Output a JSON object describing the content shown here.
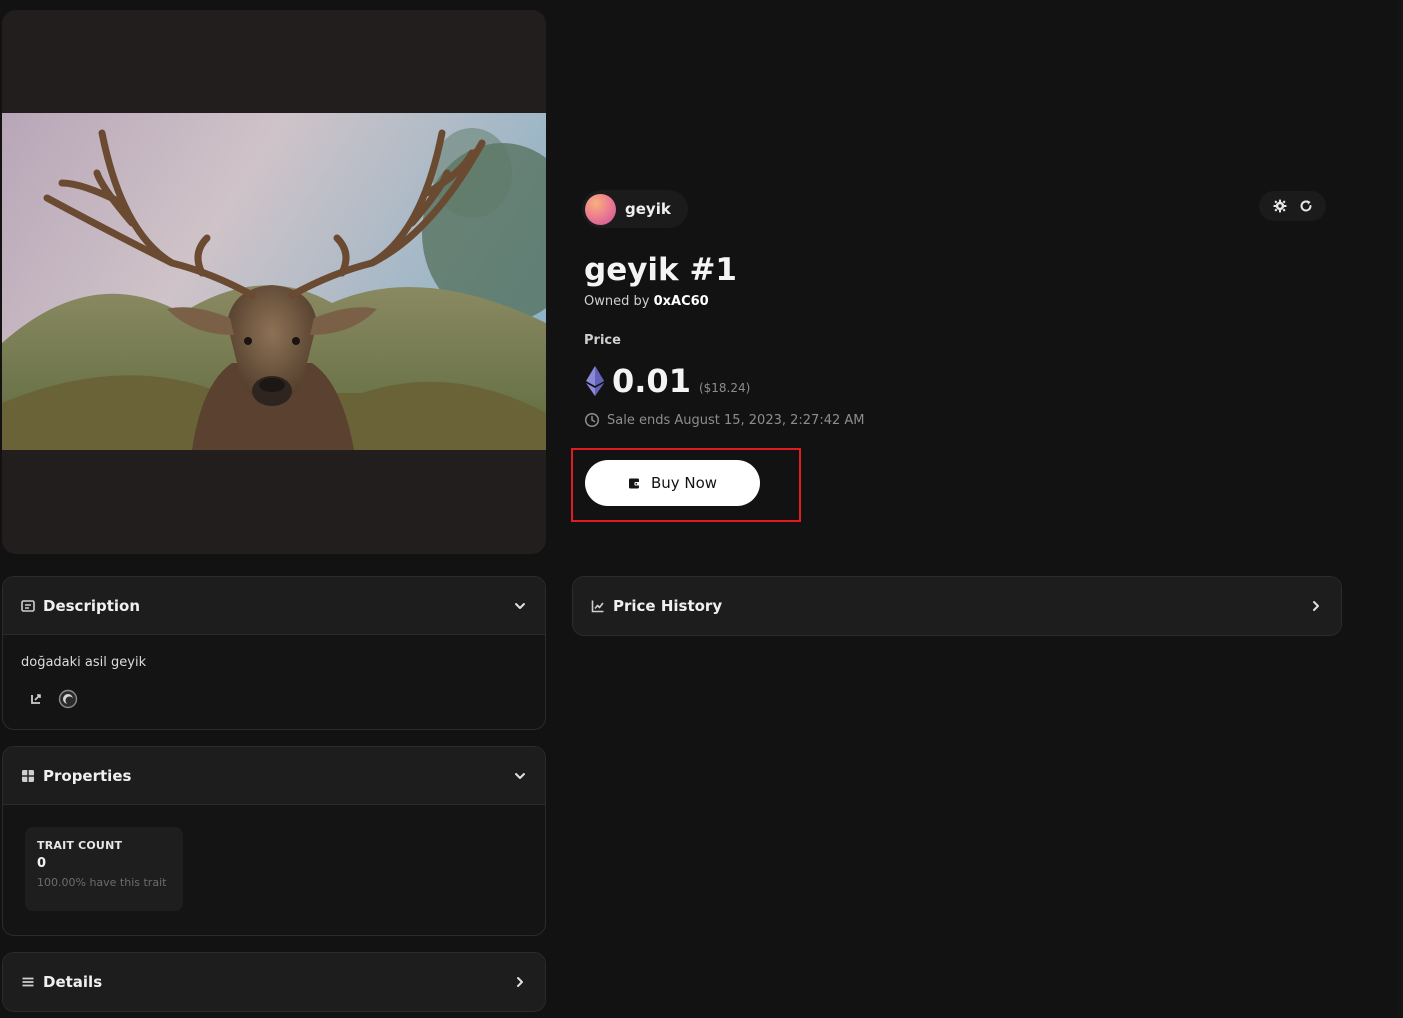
{
  "collection": {
    "name": "geyik"
  },
  "item": {
    "title": "geyik #1",
    "owned_by_label": "Owned by",
    "owner": "0xAC60"
  },
  "price": {
    "label": "Price",
    "value": "0.01",
    "usd": "($18.24)",
    "currency_icon": "ethereum-icon",
    "sale_ends": "Sale ends August 15, 2023, 2:27:42 AM"
  },
  "buy_button": {
    "label": "Buy Now"
  },
  "panels": {
    "description": {
      "title": "Description",
      "text": "doğadaki asil geyik"
    },
    "properties": {
      "title": "Properties",
      "traits": [
        {
          "type": "TRAIT COUNT",
          "value": "0",
          "rarity": "100.00% have this trait"
        }
      ]
    },
    "details": {
      "title": "Details"
    },
    "price_history": {
      "title": "Price History"
    }
  },
  "colors": {
    "background": "#121212",
    "panel_header": "#1d1d1d",
    "highlight_box": "#e11b22",
    "buy_button_bg": "#ffffff"
  }
}
